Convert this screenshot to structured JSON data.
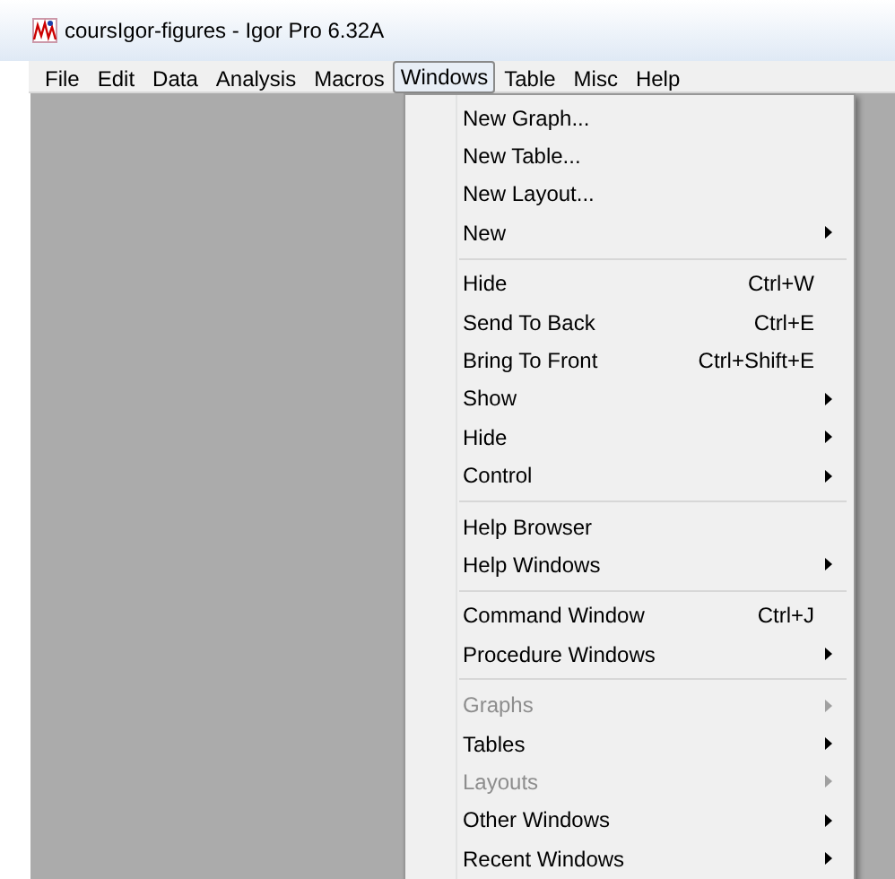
{
  "window": {
    "title": "coursIgor-figures - Igor Pro 6.32A"
  },
  "menubar": [
    {
      "label": "File",
      "selected": false
    },
    {
      "label": "Edit",
      "selected": false
    },
    {
      "label": "Data",
      "selected": false
    },
    {
      "label": "Analysis",
      "selected": false
    },
    {
      "label": "Macros",
      "selected": false
    },
    {
      "label": "Windows",
      "selected": true
    },
    {
      "label": "Table",
      "selected": false
    },
    {
      "label": "Misc",
      "selected": false
    },
    {
      "label": "Help",
      "selected": false
    }
  ],
  "menu": {
    "groups": [
      [
        {
          "label": "New Graph...",
          "submenu": false,
          "disabled": false
        },
        {
          "label": "New Table...",
          "submenu": false,
          "disabled": false
        },
        {
          "label": "New Layout...",
          "submenu": false,
          "disabled": false
        },
        {
          "label": "New",
          "submenu": true,
          "disabled": false
        }
      ],
      [
        {
          "label": "Hide",
          "shortcut": "Ctrl+W",
          "submenu": false,
          "disabled": false
        },
        {
          "label": "Send To Back",
          "shortcut": "Ctrl+E",
          "submenu": false,
          "disabled": false
        },
        {
          "label": "Bring To Front",
          "shortcut": "Ctrl+Shift+E",
          "submenu": false,
          "disabled": false
        },
        {
          "label": "Show",
          "submenu": true,
          "disabled": false
        },
        {
          "label": "Hide",
          "submenu": true,
          "disabled": false
        },
        {
          "label": "Control",
          "submenu": true,
          "disabled": false
        }
      ],
      [
        {
          "label": "Help Browser",
          "submenu": false,
          "disabled": false
        },
        {
          "label": "Help Windows",
          "submenu": true,
          "disabled": false
        }
      ],
      [
        {
          "label": "Command Window",
          "shortcut": "Ctrl+J",
          "submenu": false,
          "disabled": false
        },
        {
          "label": "Procedure Windows",
          "submenu": true,
          "disabled": false
        }
      ],
      [
        {
          "label": "Graphs",
          "submenu": true,
          "disabled": true
        },
        {
          "label": "Tables",
          "submenu": true,
          "disabled": false
        },
        {
          "label": "Layouts",
          "submenu": true,
          "disabled": true
        },
        {
          "label": "Other Windows",
          "submenu": true,
          "disabled": false
        },
        {
          "label": "Recent Windows",
          "submenu": true,
          "disabled": false
        }
      ]
    ]
  }
}
